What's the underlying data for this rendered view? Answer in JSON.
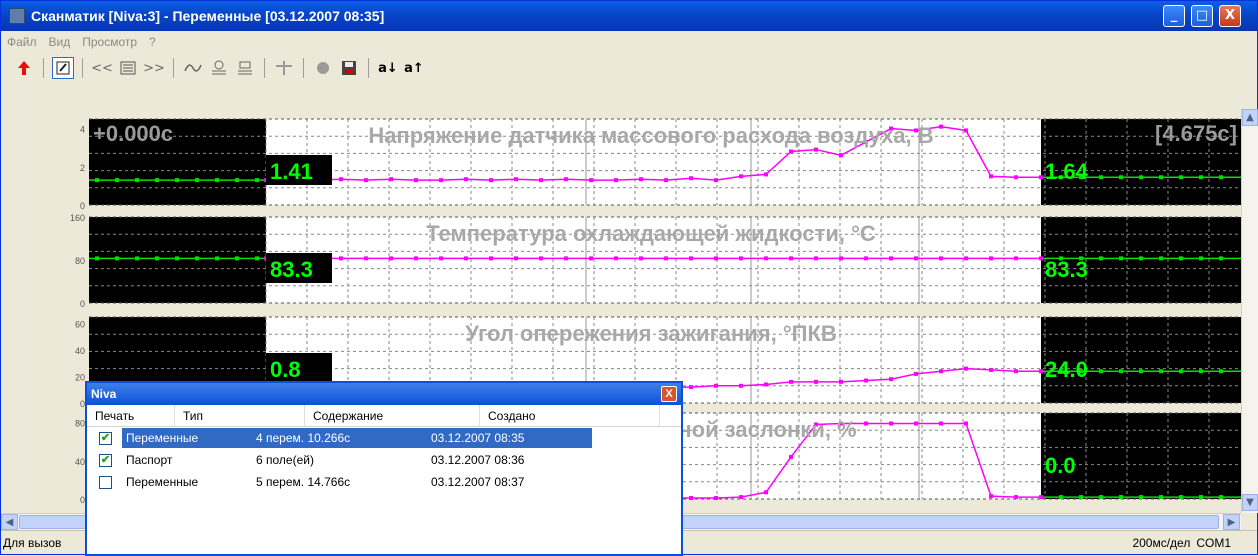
{
  "window": {
    "title": "Сканматик [Niva:3] - Переменные [03.12.2007  08:35]",
    "btn_min": "_",
    "btn_max": "□",
    "btn_close": "X"
  },
  "menu": [
    "Файл",
    "Вид",
    "Просмотр",
    "?"
  ],
  "toolbar": {
    "prev": "<<",
    "next": ">>",
    "sort_down": "a↓",
    "sort_up": "a↑"
  },
  "charts": {
    "start_time": "+0.000c",
    "end_time": "[4.675c]",
    "panels": [
      {
        "title": "Напряжение датчика массового расхода воздуха, В",
        "y_ticks": [
          "4",
          "2",
          "0"
        ],
        "left_value": "1.41",
        "right_value": "1.64",
        "ylim": [
          0,
          4.5
        ],
        "values": [
          1.3,
          1.35,
          1.3,
          1.35,
          1.3,
          1.35,
          1.3,
          1.3,
          1.35,
          1.3,
          1.35,
          1.3,
          1.35,
          1.3,
          1.3,
          1.35,
          1.3,
          1.4,
          1.3,
          1.5,
          1.6,
          2.8,
          2.9,
          2.6,
          3.3,
          4.0,
          3.9,
          4.1,
          3.9,
          1.5,
          1.45,
          1.45
        ]
      },
      {
        "title": "Температура охлаждающей жидкости, °C",
        "y_ticks": [
          "160",
          "80",
          "0"
        ],
        "left_value": "83.3",
        "right_value": "83.3",
        "ylim": [
          0,
          160
        ],
        "values": [
          83,
          83,
          83,
          83,
          83,
          83,
          83,
          83,
          83,
          83,
          83,
          83,
          83,
          83,
          83,
          83,
          83,
          83,
          83,
          83,
          83,
          83,
          83,
          83,
          83,
          83,
          83,
          83,
          83,
          83,
          83,
          83
        ]
      },
      {
        "title": "Угол опережения зажигания, °ПКВ",
        "y_ticks": [
          "60",
          "40",
          "20",
          "0"
        ],
        "left_value": "0.8",
        "right_value": "24.0",
        "ylim": [
          0,
          65
        ],
        "values": [
          11,
          11,
          11,
          12,
          11,
          11,
          12,
          11,
          12,
          11,
          12,
          11,
          12,
          11,
          12,
          11,
          12,
          12,
          13,
          13,
          14,
          16,
          16,
          16,
          17,
          18,
          22,
          24,
          26,
          25,
          24,
          24
        ]
      },
      {
        "title": "Положение дроссельной заслонки, %",
        "y_ticks": [
          "80",
          "40",
          "0"
        ],
        "left_value": "",
        "right_value": "0.0",
        "ylim": [
          0,
          90
        ],
        "values": [
          1,
          1,
          1,
          1,
          1,
          1,
          1,
          1,
          1,
          1,
          1,
          1,
          1,
          1,
          1,
          1,
          1,
          1,
          1,
          2,
          7,
          44,
          78,
          79,
          79,
          79,
          79,
          79,
          79,
          3,
          2,
          2
        ]
      }
    ]
  },
  "dialog": {
    "title": "Niva",
    "close": "X",
    "columns": [
      "Печать",
      "Тип",
      "Содержание",
      "Создано"
    ],
    "rows": [
      {
        "checked": true,
        "type": "Переменные",
        "content": "4 перем. 10.266c",
        "created": "03.12.2007  08:35",
        "selected": true
      },
      {
        "checked": true,
        "type": "Паспорт",
        "content": "6 поле(ей)",
        "created": "03.12.2007  08:36",
        "selected": false
      },
      {
        "checked": false,
        "type": "Переменные",
        "content": "5 перем. 14.766c",
        "created": "03.12.2007  08:37",
        "selected": false
      }
    ]
  },
  "status": {
    "left": "Для вызов",
    "scale": "200мс/дел",
    "port": "COM1"
  },
  "colors": {
    "trace": "#ff00ff",
    "live": "#00e000",
    "panel_bg": "#000000",
    "value_text": "#00ff00"
  }
}
